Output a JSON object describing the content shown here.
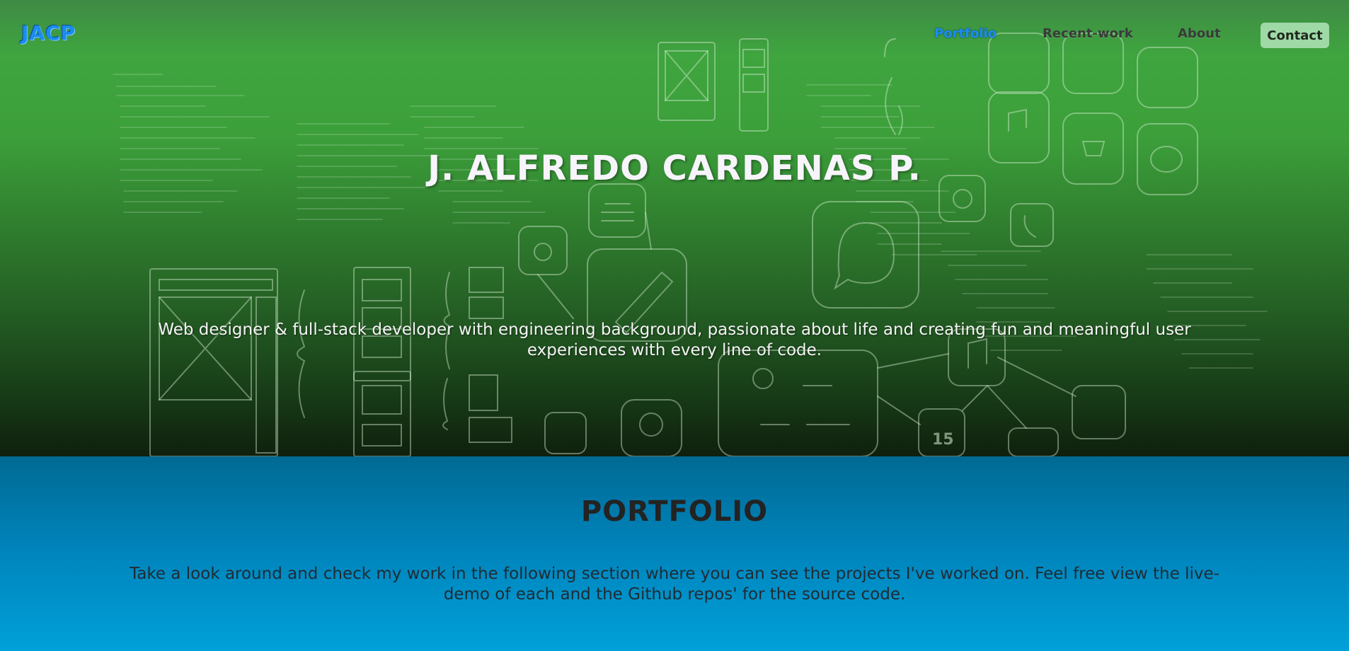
{
  "nav": {
    "logo": "JACP",
    "links": [
      {
        "label": "Portfolio",
        "active": true
      },
      {
        "label": "Recent-work",
        "active": false
      },
      {
        "label": "About",
        "active": false
      }
    ],
    "contact_label": "Contact"
  },
  "hero": {
    "title": "J. ALFREDO CARDENAS P.",
    "subtitle": "Web designer & full-stack developer with engineering background, passionate about life and creating fun and meaningful user experiences with every line of code.",
    "illustration_icons": [
      "wireframe-sketch",
      "mobile-mockup",
      "books-icon",
      "camera-icon",
      "pencil-icon",
      "chat-bubble-icon",
      "at-sign-icon",
      "phone-icon",
      "music-note-icon",
      "lightbulb-icon",
      "airplane-icon",
      "weather-icon",
      "calendar-icon",
      "app-grid-icon"
    ],
    "illustration_text": {
      "calendar_day": "15"
    }
  },
  "portfolio": {
    "title": "PORTFOLIO",
    "text": "Take a look around and check my work in the following section where you can see the projects I've worked on. Feel free view the live-demo of each and the Github repos' for the source code."
  },
  "colors": {
    "accent": "#1a8cf0",
    "contact_bg": "#9fd9a6",
    "hero_green": "#3fa53f",
    "portfolio_blue": "#0085bd"
  }
}
